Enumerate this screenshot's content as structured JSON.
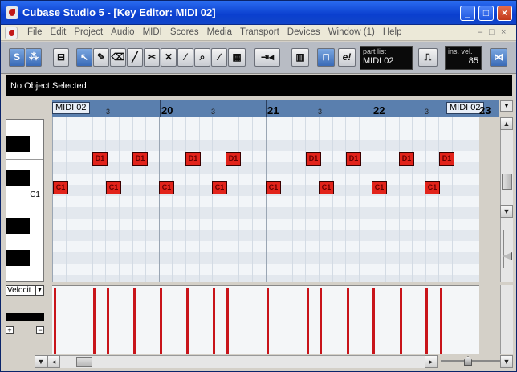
{
  "window": {
    "title": "Cubase Studio 5 - [Key Editor: MIDI 02]"
  },
  "menu": [
    "File",
    "Edit",
    "Project",
    "Audio",
    "MIDI",
    "Scores",
    "Media",
    "Transport",
    "Devices",
    "Window (1)",
    "Help"
  ],
  "toolbar": {
    "solo_label": "S",
    "info_label": "e!",
    "part_list_label": "part list",
    "part_list_value": "MIDI 02",
    "insert_velocity_label": "ins. vel.",
    "insert_velocity_value": "85"
  },
  "info_line": {
    "text": "No Object Selected"
  },
  "ruler": {
    "part_start_label": "MIDI 02",
    "part_end_label": "MIDI 02",
    "bars": [
      "20",
      "21",
      "22",
      "23"
    ],
    "subbeat": "3"
  },
  "keyboard": {
    "c1_label": "C1"
  },
  "notes": {
    "upper_label": "D1",
    "lower_label": "C1"
  },
  "velocity": {
    "selector_value": "Velocit"
  },
  "colors": {
    "note": "#e2231a",
    "velocity": "#c8141a",
    "ruler": "#5a7fae",
    "title_bar": "#0a3fcf"
  }
}
